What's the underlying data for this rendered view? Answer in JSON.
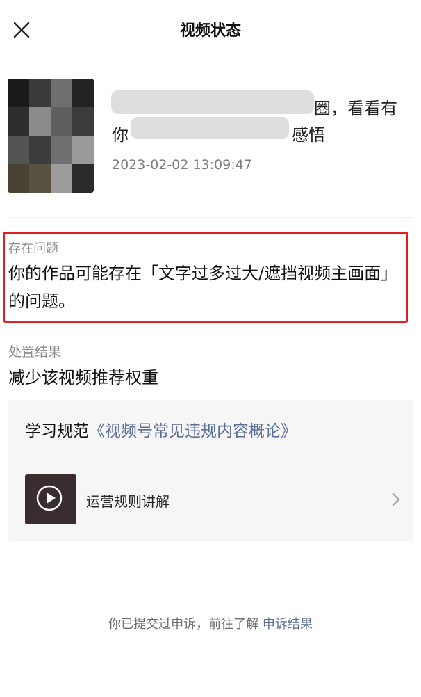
{
  "header": {
    "title": "视频状态",
    "close_icon": "close-icon"
  },
  "video": {
    "caption_line1_suffix": "圈，看看有",
    "caption_line2_prefix": "你",
    "caption_line2_suffix": "感悟",
    "date": "2023-02-02 13:09:47"
  },
  "issue": {
    "label": "存在问题",
    "text": "你的作品可能存在「文字过多过大/遮挡视频主画面」的问题。"
  },
  "result": {
    "label": "处置结果",
    "text": "减少该视频推荐权重"
  },
  "learn": {
    "prefix": "学习规范",
    "link": "《视频号常见违规内容概论》",
    "rule_title": "运营规则讲解",
    "play_icon": "play-icon",
    "chevron_icon": "chevron-right-icon"
  },
  "footer": {
    "text": "你已提交过申诉，前往了解",
    "link": "申诉结果"
  },
  "colors": {
    "highlight_border": "#e02020",
    "link": "#5a6e96",
    "panel_bg": "#f6f6f7"
  }
}
